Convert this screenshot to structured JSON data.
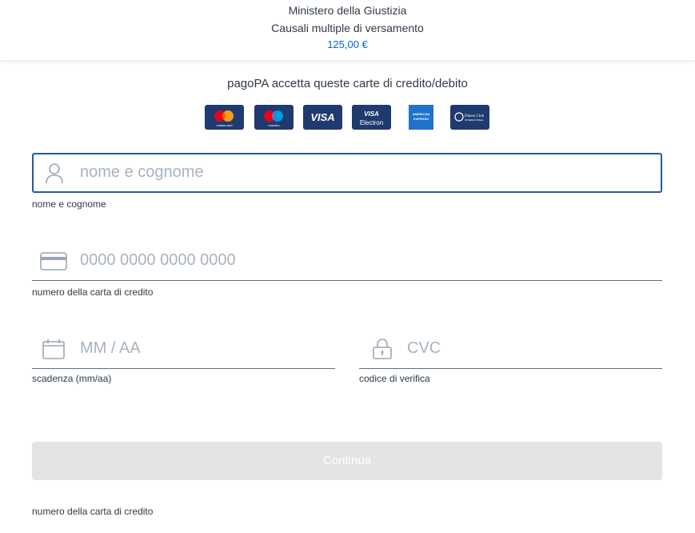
{
  "header": {
    "organization": "Ministero della Giustizia",
    "description": "Causali multiple di versamento",
    "amount": "125,00 €",
    "amount_color": "#0066cc"
  },
  "accepted_cards": {
    "title": "pagoPA accetta queste carte di credito/debito",
    "cards": [
      {
        "name": "mastercard",
        "icon": "mastercard-logo"
      },
      {
        "name": "maestro",
        "icon": "maestro-logo"
      },
      {
        "name": "VISA",
        "icon": "visa-logo"
      },
      {
        "name": "VISA Electron",
        "icon": "visa-electron-logo"
      },
      {
        "name": "AMERICAN EXPRESS",
        "icon": "amex-logo"
      },
      {
        "name": "Diners Club",
        "icon": "diners-club-logo"
      }
    ]
  },
  "form": {
    "name": {
      "placeholder": "nome e cognome",
      "label": "nome e cognome",
      "icon": "user-icon"
    },
    "card_number": {
      "placeholder": "0000 0000 0000 0000",
      "label": "numero della carta di credito",
      "icon": "credit-card-icon"
    },
    "expiry": {
      "placeholder": "MM / AA",
      "label": "scadenza (mm/aa)",
      "icon": "calendar-icon"
    },
    "cvc": {
      "placeholder": "CVC",
      "label": "codice di verifica",
      "icon": "lock-icon"
    }
  },
  "submit": {
    "label": "Continua",
    "enabled": false
  },
  "footnote": "numero della carta di credito",
  "colors": {
    "focus_border": "#2656a8",
    "card_bg": "#1f3a6e",
    "disabled_button": "#e3e4e6"
  }
}
